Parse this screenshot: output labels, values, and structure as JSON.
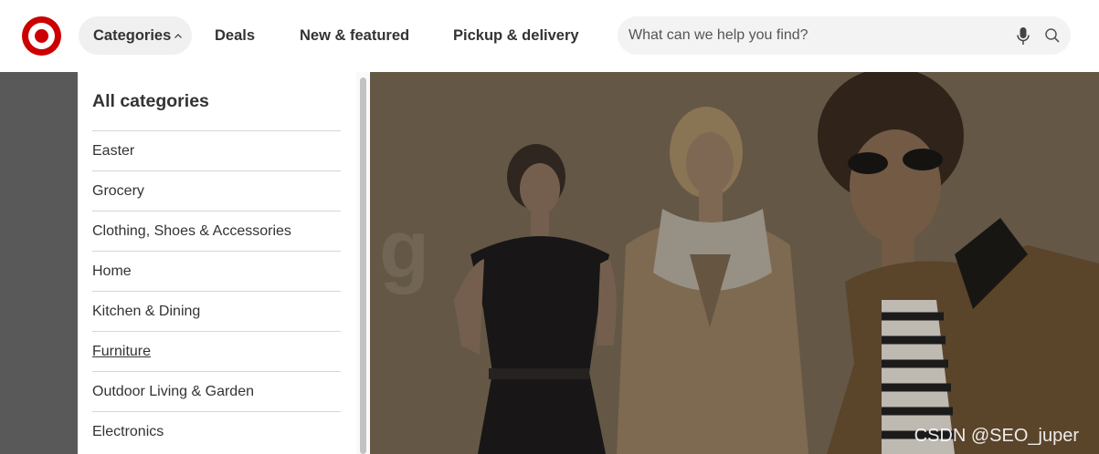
{
  "brand": {
    "logo_color": "#cc0000"
  },
  "nav": {
    "categories_label": "Categories",
    "categories_chevron": "^",
    "deals_label": "Deals",
    "new_featured_label": "New & featured",
    "pickup_delivery_label": "Pickup & delivery"
  },
  "search": {
    "placeholder": "What can we help you find?",
    "value": "",
    "mic_icon": "microphone-icon",
    "search_icon": "magnifier-icon"
  },
  "categories_panel": {
    "title": "All categories",
    "items": [
      {
        "label": "Easter"
      },
      {
        "label": "Grocery"
      },
      {
        "label": "Clothing, Shoes & Accessories"
      },
      {
        "label": "Home"
      },
      {
        "label": "Kitchen & Dining"
      },
      {
        "label": "Furniture"
      },
      {
        "label": "Outdoor Living & Garden"
      },
      {
        "label": "Electronics"
      }
    ],
    "hovered_item": "Furniture"
  },
  "watermark": "CSDN @SEO_juper",
  "colors": {
    "overlay": "#595959",
    "text": "#333333",
    "divider": "#d6d6d6"
  }
}
